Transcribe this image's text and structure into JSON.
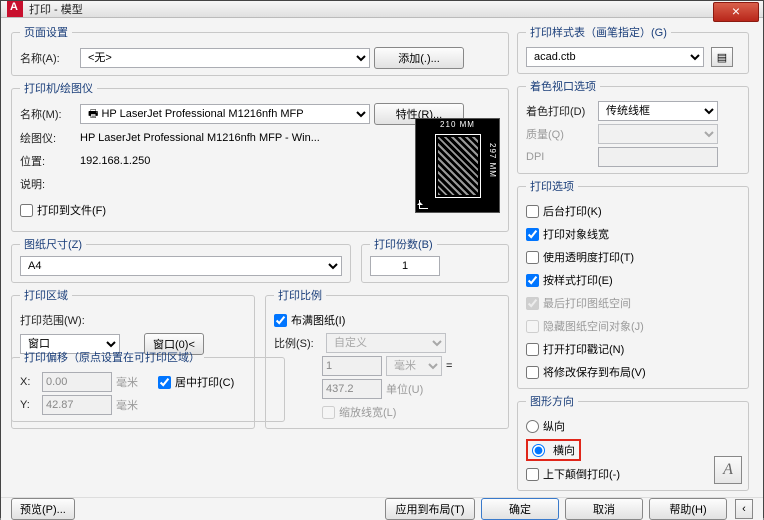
{
  "window": {
    "title": "打印 - 模型"
  },
  "pageSetup": {
    "legend": "页面设置",
    "nameLabel": "名称(A):",
    "name": "<无>",
    "addBtn": "添加(.)..."
  },
  "printer": {
    "legend": "打印机/绘图仪",
    "nameLabel": "名称(M):",
    "name": "HP LaserJet Professional M1216nfh MFP",
    "propsBtn": "特性(R)...",
    "plotterLabel": "绘图仪:",
    "plotter": "HP LaserJet Professional M1216nfh MFP - Win...",
    "locationLabel": "位置:",
    "location": "192.168.1.250",
    "descLabel": "说明:",
    "toFile": "打印到文件(F)",
    "preview": {
      "w": "210 MM",
      "h": "297 MM"
    }
  },
  "paperSize": {
    "legend": "图纸尺寸(Z)",
    "value": "A4"
  },
  "copies": {
    "legend": "打印份数(B)",
    "value": "1"
  },
  "area": {
    "legend": "打印区域",
    "rangeLabel": "打印范围(W):",
    "range": "窗口",
    "windowBtn": "窗口(0)<"
  },
  "scale": {
    "legend": "打印比例",
    "fit": "布满图纸(I)",
    "ratioLabel": "比例(S):",
    "ratio": "自定义",
    "one": "1",
    "unitTop": "毫米",
    "eq": "=",
    "unitVal": "437.2",
    "unitLabel": "单位(U)",
    "scaleLine": "缩放线宽(L)"
  },
  "offset": {
    "legend": "打印偏移（原点设置在可打印区域）",
    "xLabel": "X:",
    "x": "0.00",
    "xUnit": "毫米",
    "center": "居中打印(C)",
    "yLabel": "Y:",
    "y": "42.87",
    "yUnit": "毫米"
  },
  "styleTable": {
    "legend": "打印样式表（画笔指定）(G)",
    "value": "acad.ctb"
  },
  "shaded": {
    "legend": "着色视口选项",
    "shadeLabel": "着色打印(D)",
    "shade": "传统线框",
    "qualityLabel": "质量(Q)",
    "dpiLabel": "DPI"
  },
  "options": {
    "legend": "打印选项",
    "bg": "后台打印(K)",
    "lw": "打印对象线宽",
    "trans": "使用透明度打印(T)",
    "styles": "按样式打印(E)",
    "last": "最后打印图纸空间",
    "hide": "隐藏图纸空间对象(J)",
    "stamp": "打开打印戳记(N)",
    "save": "将修改保存到布局(V)"
  },
  "orient": {
    "legend": "图形方向",
    "portrait": "纵向",
    "landscape": "横向",
    "upside": "上下颠倒打印(-)"
  },
  "footer": {
    "preview": "预览(P)...",
    "apply": "应用到布局(T)",
    "ok": "确定",
    "cancel": "取消",
    "help": "帮助(H)"
  }
}
